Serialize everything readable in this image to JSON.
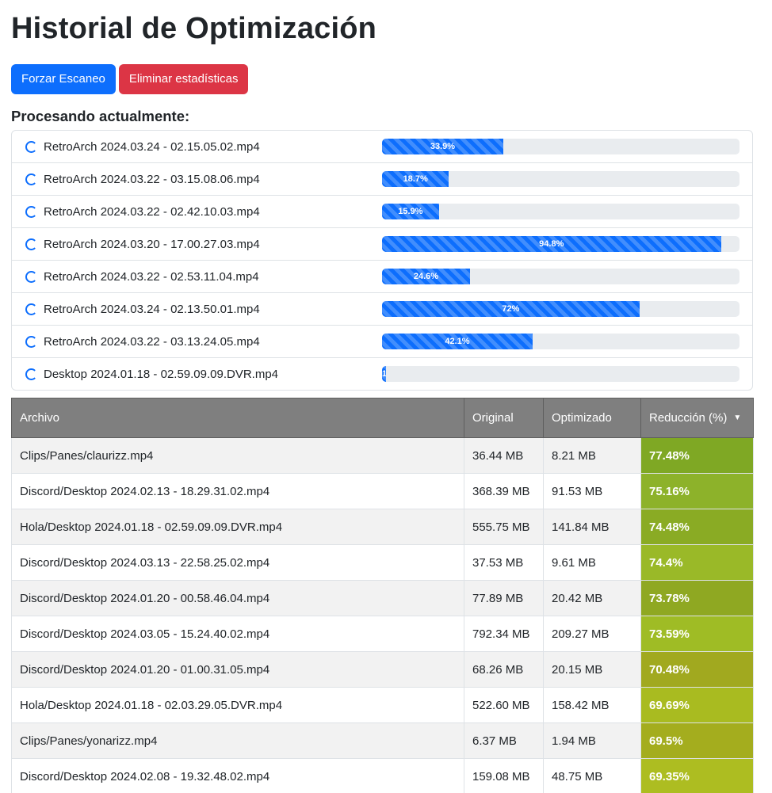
{
  "page": {
    "title": "Historial de Optimización"
  },
  "toolbar": {
    "scan_label": "Forzar Escaneo",
    "delete_label": "Eliminar estadísticas"
  },
  "processing": {
    "heading": "Procesando actualmente:",
    "items": [
      {
        "name": "RetroArch 2024.03.24 - 02.15.05.02.mp4",
        "progress": 33.9,
        "label": "33.9%"
      },
      {
        "name": "RetroArch 2024.03.22 - 03.15.08.06.mp4",
        "progress": 18.7,
        "label": "18.7%"
      },
      {
        "name": "RetroArch 2024.03.22 - 02.42.10.03.mp4",
        "progress": 15.9,
        "label": "15.9%"
      },
      {
        "name": "RetroArch 2024.03.20 - 17.00.27.03.mp4",
        "progress": 94.8,
        "label": "94.8%"
      },
      {
        "name": "RetroArch 2024.03.22 - 02.53.11.04.mp4",
        "progress": 24.6,
        "label": "24.6%"
      },
      {
        "name": "RetroArch 2024.03.24 - 02.13.50.01.mp4",
        "progress": 72,
        "label": "72%"
      },
      {
        "name": "RetroArch 2024.03.22 - 03.13.24.05.mp4",
        "progress": 42.1,
        "label": "42.1%"
      },
      {
        "name": "Desktop 2024.01.18 - 02.59.09.09.DVR.mp4",
        "progress": 1.2,
        "label": "1"
      }
    ]
  },
  "table": {
    "headers": {
      "file": "Archivo",
      "original": "Original",
      "optimized": "Optimizado",
      "reduction": "Reducción (%)"
    },
    "sort_icon": "caret-down-icon",
    "rows": [
      {
        "file": "Clips/Panes/claurizz.mp4",
        "original": "36.44 MB",
        "optimized": "8.21 MB",
        "reduction": "77.48%",
        "color": "#7fa824"
      },
      {
        "file": "Discord/Desktop 2024.02.13 - 18.29.31.02.mp4",
        "original": "368.39 MB",
        "optimized": "91.53 MB",
        "reduction": "75.16%",
        "color": "#8db22a"
      },
      {
        "file": "Hola/Desktop 2024.01.18 - 02.59.09.09.DVR.mp4",
        "original": "555.75 MB",
        "optimized": "141.84 MB",
        "reduction": "74.48%",
        "color": "#8aab24"
      },
      {
        "file": "Discord/Desktop 2024.03.13 - 22.58.25.02.mp4",
        "original": "37.53 MB",
        "optimized": "9.61 MB",
        "reduction": "74.4%",
        "color": "#9ab928"
      },
      {
        "file": "Discord/Desktop 2024.01.20 - 00.58.46.04.mp4",
        "original": "77.89 MB",
        "optimized": "20.42 MB",
        "reduction": "73.78%",
        "color": "#8fa822"
      },
      {
        "file": "Discord/Desktop 2024.03.05 - 15.24.40.02.mp4",
        "original": "792.34 MB",
        "optimized": "209.27 MB",
        "reduction": "73.59%",
        "color": "#9fbc25"
      },
      {
        "file": "Discord/Desktop 2024.01.20 - 01.00.31.05.mp4",
        "original": "68.26 MB",
        "optimized": "20.15 MB",
        "reduction": "70.48%",
        "color": "#a1a91f"
      },
      {
        "file": "Hola/Desktop 2024.01.18 - 02.03.29.05.DVR.mp4",
        "original": "522.60 MB",
        "optimized": "158.42 MB",
        "reduction": "69.69%",
        "color": "#a9bb20"
      },
      {
        "file": "Clips/Panes/yonarizz.mp4",
        "original": "6.37 MB",
        "optimized": "1.94 MB",
        "reduction": "69.5%",
        "color": "#a4ad1e"
      },
      {
        "file": "Discord/Desktop 2024.02.08 - 19.32.48.02.mp4",
        "original": "159.08 MB",
        "optimized": "48.75 MB",
        "reduction": "69.35%",
        "color": "#adbd21"
      }
    ]
  }
}
